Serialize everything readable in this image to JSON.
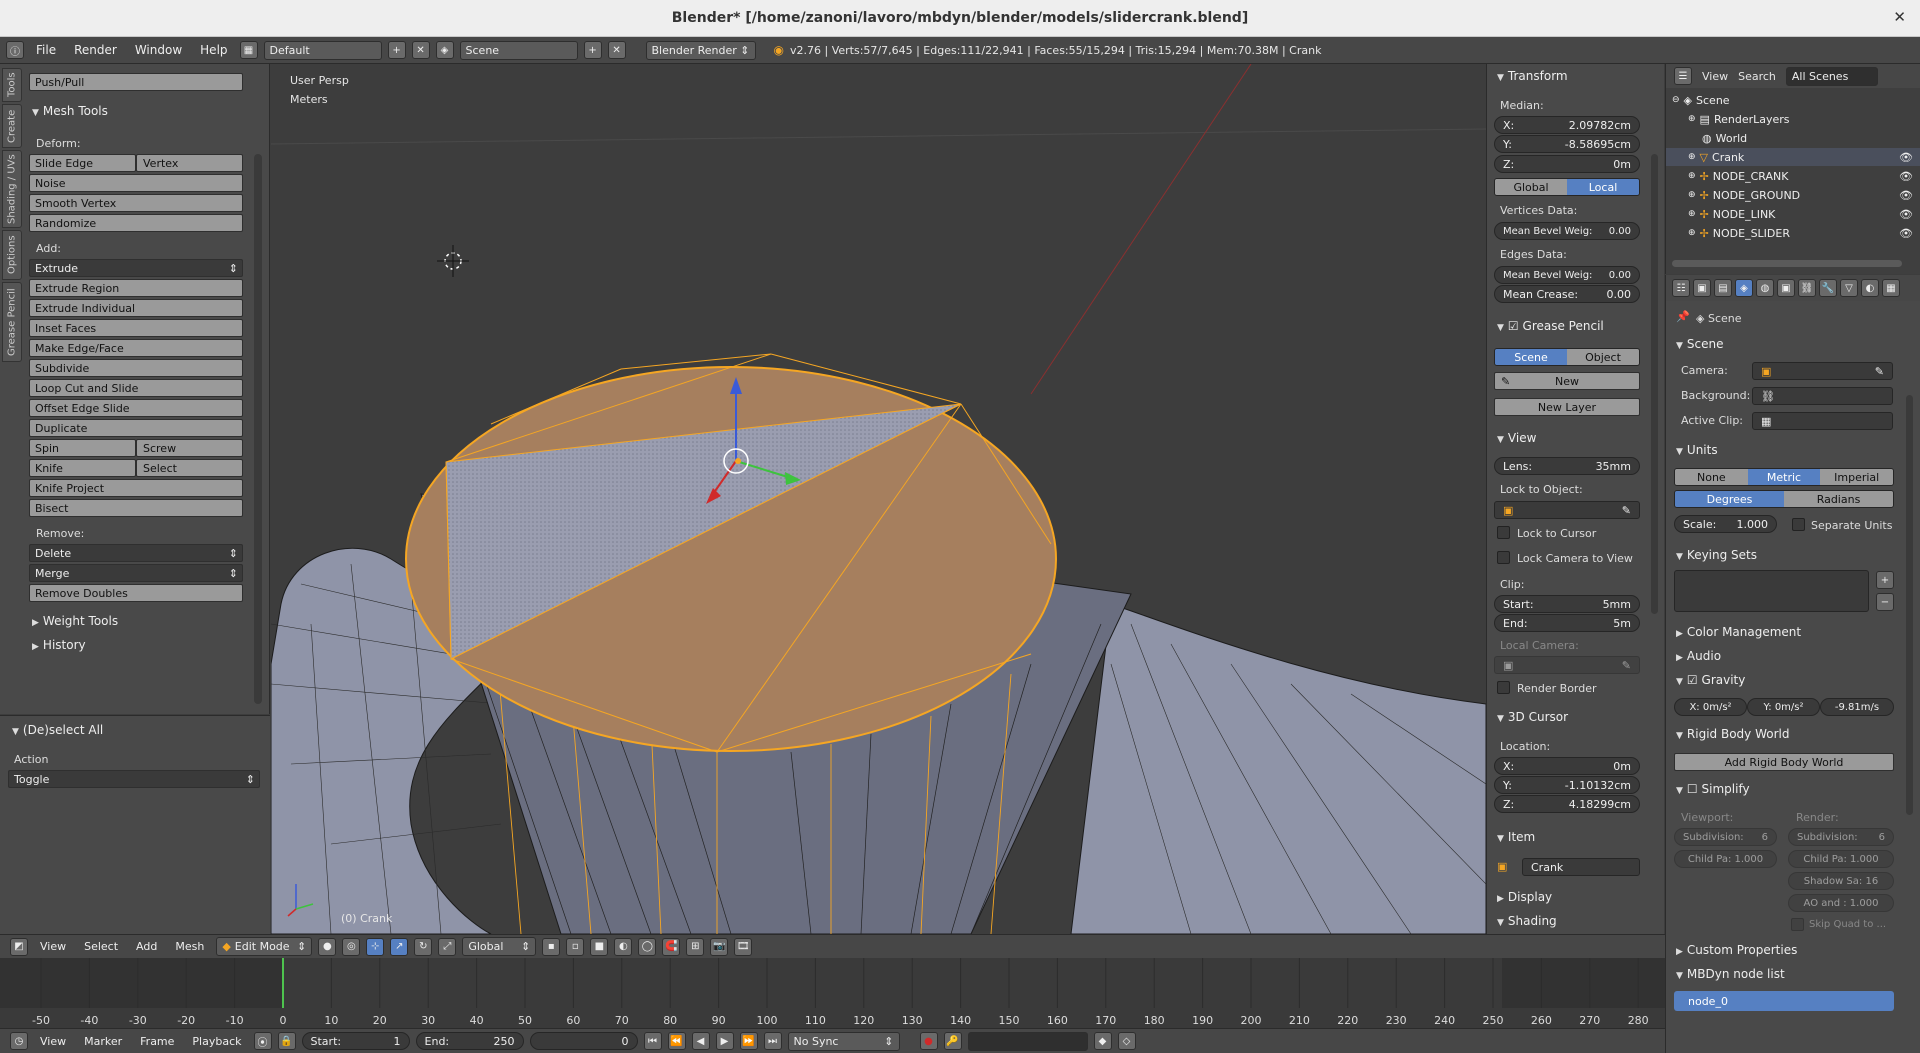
{
  "window": {
    "title": "Blender* [/home/zanoni/lavoro/mbdyn/blender/models/slidercrank.blend]"
  },
  "infobar": {
    "menus": [
      "File",
      "Render",
      "Window",
      "Help"
    ],
    "layout": "Default",
    "scene": "Scene",
    "engine": "Blender Render",
    "stats": "v2.76 | Verts:57/7,645 | Edges:111/22,941 | Faces:55/15,294 | Tris:15,294 | Mem:70.38M | Crank"
  },
  "toolshelf": {
    "tabs": [
      "Tools",
      "Create",
      "Shading / UVs",
      "Options",
      "Grease Pencil"
    ],
    "top_button": "Push/Pull",
    "mesh_tools_title": "Mesh Tools",
    "deform_label": "Deform:",
    "slide_edge": "Slide Edge",
    "vertex": "Vertex",
    "noise": "Noise",
    "smooth_vertex": "Smooth Vertex",
    "randomize": "Randomize",
    "add_label": "Add:",
    "extrude": "Extrude",
    "extrude_region": "Extrude Region",
    "extrude_individual": "Extrude Individual",
    "inset_faces": "Inset Faces",
    "make_edge_face": "Make Edge/Face",
    "subdivide": "Subdivide",
    "loop_cut": "Loop Cut and Slide",
    "offset_edge": "Offset Edge Slide",
    "duplicate": "Duplicate",
    "spin": "Spin",
    "screw": "Screw",
    "knife": "Knife",
    "select": "Select",
    "knife_project": "Knife Project",
    "bisect": "Bisect",
    "remove_label": "Remove:",
    "delete": "Delete",
    "merge": "Merge",
    "remove_doubles": "Remove Doubles",
    "weight_tools": "Weight Tools",
    "history": "History"
  },
  "operator": {
    "title": "(De)select All",
    "action_label": "Action",
    "action_value": "Toggle"
  },
  "viewport": {
    "persp": "User Persp",
    "units": "Meters",
    "object_label": "(0) Crank"
  },
  "npanel": {
    "transform": "Transform",
    "median": "Median:",
    "x_label": "X:",
    "x_val": "2.09782cm",
    "y_label": "Y:",
    "y_val": "-8.58695cm",
    "z_label": "Z:",
    "z_val": "0m",
    "global": "Global",
    "local": "Local",
    "vertices_data": "Vertices Data:",
    "mean_bevel_v": "Mean Bevel Weig:",
    "mean_bevel_v_val": "0.00",
    "edges_data": "Edges Data:",
    "mean_bevel_e": "Mean Bevel Weig:",
    "mean_bevel_e_val": "0.00",
    "mean_crease": "Mean Crease:",
    "mean_crease_val": "0.00",
    "grease_pencil": "Grease Pencil",
    "gp_scene": "Scene",
    "gp_object": "Object",
    "gp_new": "New",
    "gp_new_layer": "New Layer",
    "view": "View",
    "lens_label": "Lens:",
    "lens_val": "35mm",
    "lock_to_object": "Lock to Object:",
    "lock_to_cursor": "Lock to Cursor",
    "lock_camera": "Lock Camera to View",
    "clip": "Clip:",
    "clip_start": "Start:",
    "clip_start_val": "5mm",
    "clip_end": "End:",
    "clip_end_val": "5m",
    "local_camera": "Local Camera:",
    "render_border": "Render Border",
    "cursor3d": "3D Cursor",
    "location": "Location:",
    "cx_val": "0m",
    "cy_val": "-1.10132cm",
    "cz_val": "4.18299cm",
    "item": "Item",
    "item_name": "Crank",
    "display": "Display",
    "shading": "Shading"
  },
  "outliner": {
    "header": {
      "view": "View",
      "search": "Search",
      "scenes": "All Scenes"
    },
    "rows": [
      "Scene",
      "RenderLayers",
      "World",
      "Crank",
      "NODE_CRANK",
      "NODE_GROUND",
      "NODE_LINK",
      "NODE_SLIDER"
    ]
  },
  "props": {
    "context": "Scene",
    "scene_panel": "Scene",
    "camera": "Camera:",
    "background": "Background:",
    "active_clip": "Active Clip:",
    "units_panel": "Units",
    "none": "None",
    "metric": "Metric",
    "imperial": "Imperial",
    "degrees": "Degrees",
    "radians": "Radians",
    "scale": "Scale:",
    "scale_val": "1.000",
    "separate_units": "Separate Units",
    "keying_sets": "Keying Sets",
    "color_management": "Color Management",
    "audio": "Audio",
    "gravity": "Gravity",
    "gx": "X: 0m/s²",
    "gy": "Y: 0m/s²",
    "gz": "-9.81m/s",
    "rigid_body_world": "Rigid Body World",
    "add_rigid": "Add Rigid Body World",
    "simplify": "Simplify",
    "viewport_label": "Viewport:",
    "render_label": "Render:",
    "subdivision_v": "Subdivision:",
    "subdivision_v_val": "6",
    "subdivision_r": "Subdivision:",
    "subdivision_r_val": "6",
    "childpa_v": "Child Pa: 1.000",
    "childpa_r": "Child Pa: 1.000",
    "shadow": "Shadow Sa: 16",
    "ao": "AO and : 1.000",
    "skip_quad": "Skip Quad to ...",
    "custom_properties": "Custom Properties",
    "mbdyn": "MBDyn node list",
    "node0": "node_0"
  },
  "v3dheader": {
    "menus": [
      "View",
      "Select",
      "Add",
      "Mesh"
    ],
    "mode": "Edit Mode",
    "orientation": "Global"
  },
  "timeline": {
    "ticks": [
      "-50",
      "-40",
      "-30",
      "-20",
      "-10",
      "0",
      "10",
      "20",
      "30",
      "40",
      "50",
      "60",
      "70",
      "80",
      "90",
      "100",
      "110",
      "120",
      "130",
      "140",
      "150",
      "160",
      "170",
      "180",
      "190",
      "200",
      "210",
      "220",
      "230",
      "240",
      "250",
      "260",
      "270",
      "280"
    ],
    "menus": [
      "View",
      "Marker",
      "Frame",
      "Playback"
    ],
    "start_label": "Start:",
    "start_val": "1",
    "end_label": "End:",
    "end_val": "250",
    "current": "0",
    "sync": "No Sync"
  },
  "colors": {
    "selected": "#f5a623",
    "accent": "#5680c2"
  }
}
